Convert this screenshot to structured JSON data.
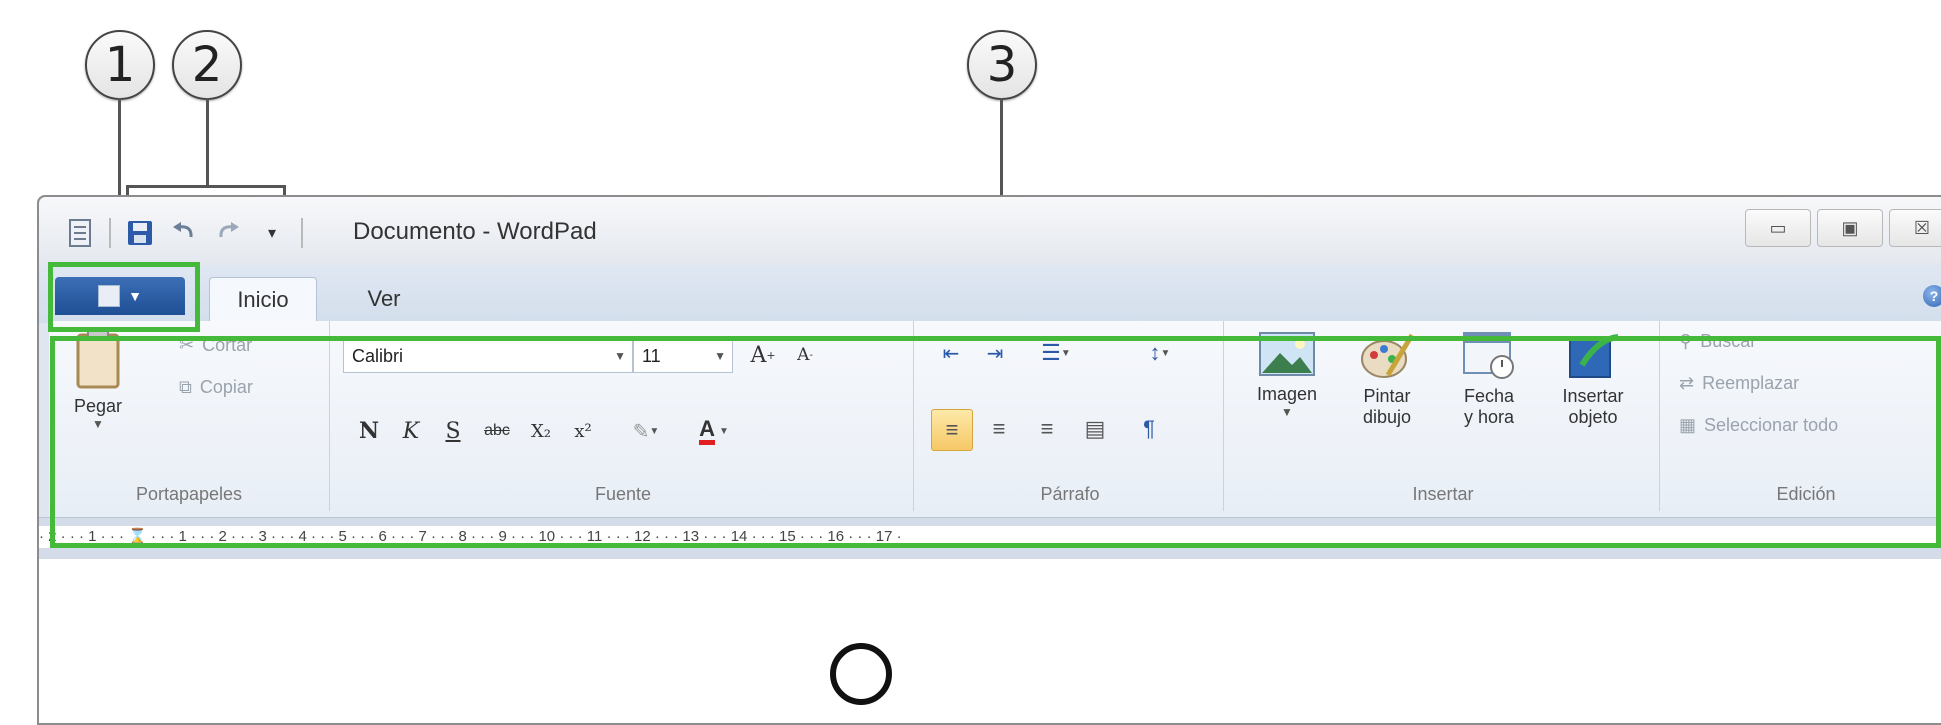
{
  "callouts": [
    "1",
    "2",
    "3"
  ],
  "window": {
    "title": "Documento - WordPad",
    "controls": {
      "minimize": "▭",
      "maximize": "▣",
      "close": "☒"
    }
  },
  "tabs": [
    "Inicio",
    "Ver"
  ],
  "ribbon": {
    "groups": {
      "clipboard": {
        "label": "Portapapeles",
        "paste": "Pegar",
        "cut": "Cortar",
        "copy": "Copiar"
      },
      "font": {
        "label": "Fuente",
        "family": "Calibri",
        "size": "11",
        "bold": "N",
        "italic": "K",
        "underline": "S",
        "strike": "abc",
        "subscript": "X₂",
        "superscript": "x²"
      },
      "paragraph": {
        "label": "Párrafo"
      },
      "insert": {
        "label": "Insertar",
        "image": "Imagen",
        "paint_1": "Pintar",
        "paint_2": "dibujo",
        "date_1": "Fecha",
        "date_2": "y hora",
        "object_1": "Insertar",
        "object_2": "objeto"
      },
      "editing": {
        "label": "Edición",
        "find": "Buscar",
        "replace": "Reemplazar",
        "select_all": "Seleccionar todo"
      }
    }
  },
  "ruler": "· 2 · · · 1 · · · ⌛ · · · 1 · · · 2 · · · 3 · · · 4 · · · 5 · · · 6 · · · 7 · · · 8 · · · 9 · · · 10 · · · 11 · · · 12 · · · 13 · · · 14 · · · 15 · · · 16 · · · 17 ·",
  "accent_colors": {
    "highlight": "#45b93a",
    "app_button": "#2a5ca3"
  }
}
